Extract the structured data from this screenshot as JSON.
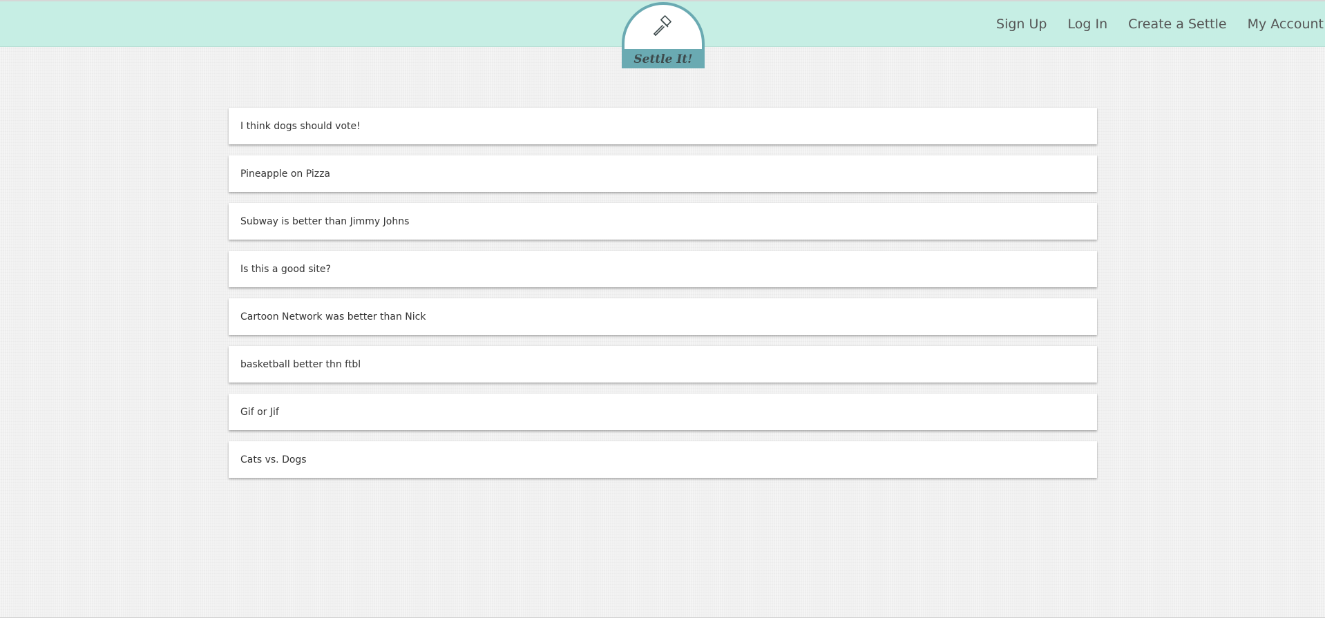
{
  "colors": {
    "navbar_bg": "#c6eee4",
    "logo_teal": "#6aaab2",
    "page_bg": "#f0f0f0",
    "card_bg": "#ffffff",
    "nav_text": "#555555"
  },
  "logo": {
    "text": "Settle It!",
    "icon": "gavel-icon"
  },
  "nav": {
    "links": [
      {
        "label": "Sign Up"
      },
      {
        "label": "Log In"
      },
      {
        "label": "Create a Settle"
      },
      {
        "label": "My Account"
      }
    ]
  },
  "settles": [
    {
      "title": "I think dogs should vote!"
    },
    {
      "title": "Pineapple on Pizza"
    },
    {
      "title": "Subway is better than Jimmy Johns"
    },
    {
      "title": "Is this a good site?"
    },
    {
      "title": "Cartoon Network was better than Nick"
    },
    {
      "title": "basketball better thn ftbl"
    },
    {
      "title": "Gif or Jif"
    },
    {
      "title": "Cats vs. Dogs"
    }
  ]
}
